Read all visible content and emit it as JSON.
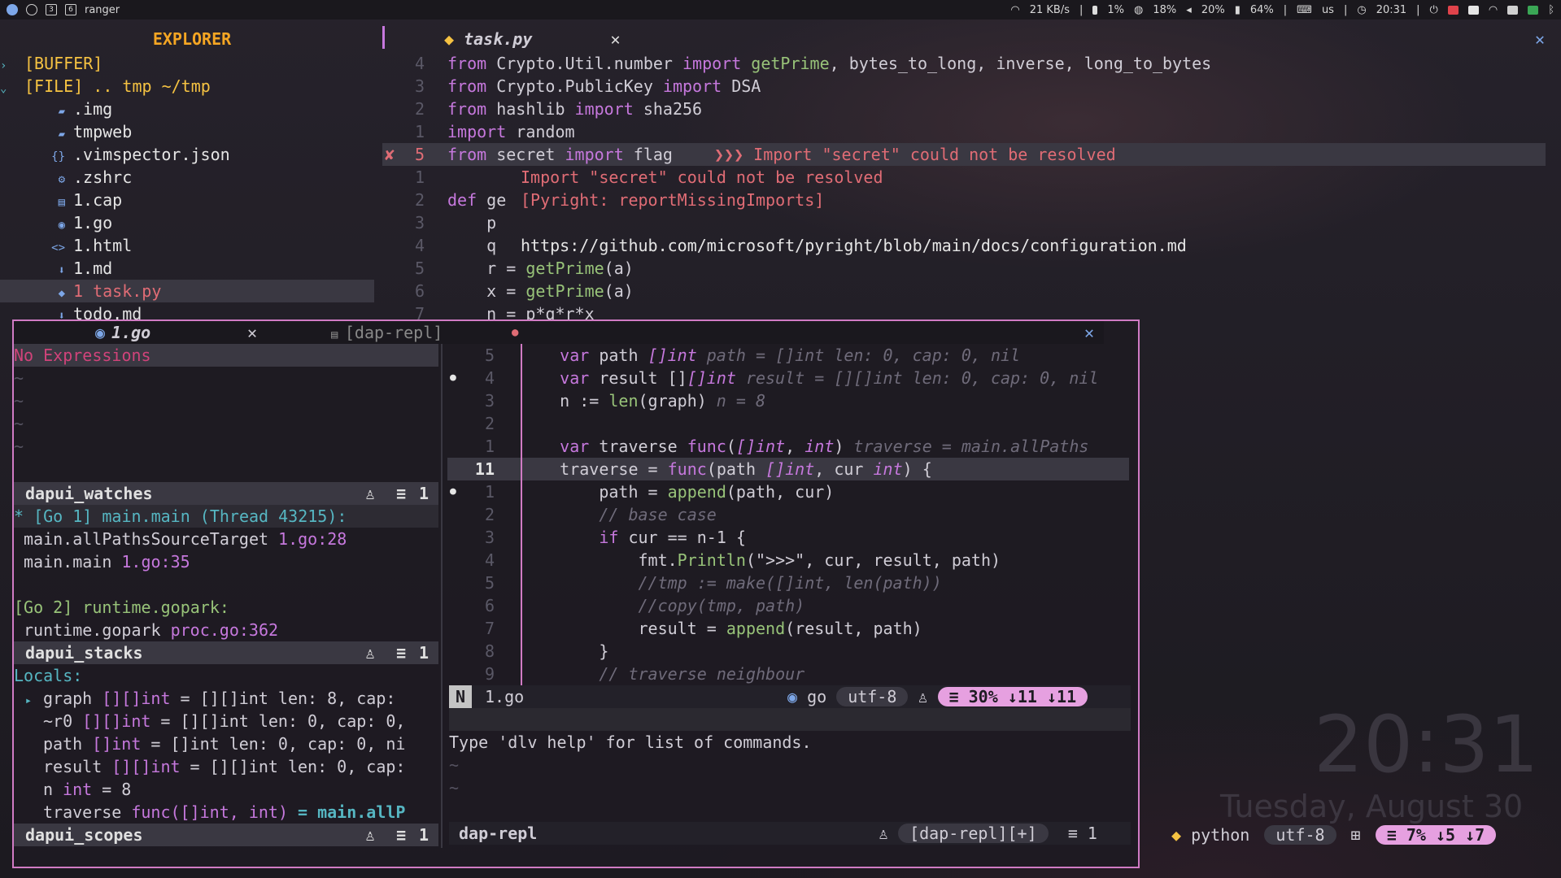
{
  "topbar": {
    "workspace_labels": [
      "3",
      "6"
    ],
    "window_title": "ranger",
    "net_speed": "21 KB/s",
    "cpu": "1%",
    "mem": "18%",
    "volume": "20%",
    "battery": "64%",
    "kbd_layout": "us",
    "time": "20:31"
  },
  "explorer": {
    "title": "EXPLORER",
    "items": [
      {
        "icon": "›",
        "label": "[BUFFER]",
        "indent": 0
      },
      {
        "icon": "⌄",
        "label": "[FILE] .. tmp ~/tmp",
        "indent": 0
      },
      {
        "icon": "▰",
        "label": ".img",
        "indent": 1
      },
      {
        "icon": "▰",
        "label": "tmpweb",
        "indent": 1
      },
      {
        "icon": "{}",
        "label": ".vimspector.json",
        "indent": 1
      },
      {
        "icon": "⚙",
        "label": ".zshrc",
        "indent": 1
      },
      {
        "icon": "▤",
        "label": "1.cap",
        "indent": 1
      },
      {
        "icon": "◉",
        "label": "1.go",
        "indent": 1
      },
      {
        "icon": "<>",
        "label": "1.html",
        "indent": 1
      },
      {
        "icon": "⬇",
        "label": "1.md",
        "indent": 1
      },
      {
        "icon": "◆",
        "label": "1 task.py",
        "indent": 1
      },
      {
        "icon": "⬇",
        "label": "todo.md",
        "indent": 1
      }
    ]
  },
  "editor": {
    "tab_label": "task.py",
    "code": [
      {
        "ln": "4",
        "text": "from Crypto.Util.number import getPrime, bytes_to_long, inverse, long_to_bytes"
      },
      {
        "ln": "3",
        "text": "from Crypto.PublicKey import DSA"
      },
      {
        "ln": "2",
        "text": "from hashlib import sha256"
      },
      {
        "ln": "1",
        "text": "import random"
      },
      {
        "ln": "5",
        "text": "from secret import flag"
      },
      {
        "ln": "1",
        "text": ""
      },
      {
        "ln": "2",
        "text": "def ge"
      },
      {
        "ln": "3",
        "text": "    p"
      },
      {
        "ln": "4",
        "text": "    q"
      },
      {
        "ln": "5",
        "text": "    r = getPrime(a)"
      },
      {
        "ln": "6",
        "text": "    x = getPrime(a)"
      },
      {
        "ln": "7",
        "text": "    n = p*q*r*x"
      }
    ],
    "diag_mark": "✘",
    "diag_inline": "❯❯❯ Import \"secret\" could not be resolved",
    "diag_popup": [
      "Import \"secret\" could not be resolved",
      "[Pyright: reportMissingImports]",
      "",
      "https://github.com/microsoft/pyright/blob/main/docs/configuration.md"
    ]
  },
  "dap": {
    "tab_go": "1.go",
    "tab_repl": "[dap-repl]",
    "no_expressions": "No Expressions",
    "watches_title": "dapui_watches",
    "stacks_title": "dapui_stacks",
    "scopes_title": "dapui_scopes",
    "pane_count": "1",
    "stacks": [
      {
        "prefix": "* ",
        "text": "[Go 1] main.main (Thread 43215):",
        "cls": "cyan"
      },
      {
        "fn": "main.allPathsSourceTarget",
        "loc": "1.go:28"
      },
      {
        "fn": "main.main",
        "loc": "1.go:35"
      },
      {
        "text": ""
      },
      {
        "text": "[Go 2] runtime.gopark:",
        "cls": "fn"
      },
      {
        "fn": "runtime.gopark",
        "loc": "proc.go:362"
      }
    ],
    "locals_label": "Locals:",
    "locals": [
      {
        "bullet": "▸",
        "name": "graph",
        "type": "[][]int",
        "val": "= [][]int len: 8, cap:"
      },
      {
        "bullet": "",
        "name": "~r0",
        "type": "[][]int",
        "val": "= [][]int len: 0, cap: 0,"
      },
      {
        "bullet": "",
        "name": "path",
        "type": "[]int",
        "val": "= []int len: 0, cap: 0, ni"
      },
      {
        "bullet": "",
        "name": "result",
        "type": "[][]int",
        "val": "= [][]int len: 0, cap:"
      },
      {
        "bullet": "",
        "name": "n",
        "type": "int",
        "val": "= 8"
      },
      {
        "bullet": "",
        "name": "traverse",
        "type": "func([]int, int)",
        "val": "= main.allP"
      }
    ],
    "go_code": [
      {
        "ln": "5",
        "bp": false,
        "text": "    var path []int",
        "hint": "path = []int len: 0, cap: 0, nil"
      },
      {
        "ln": "4",
        "bp": true,
        "text": "    var result [][]int",
        "hint": "result = [][]int len: 0, cap: 0, nil"
      },
      {
        "ln": "3",
        "bp": false,
        "text": "    n := len(graph)",
        "hint": "n = 8"
      },
      {
        "ln": "2",
        "bp": false,
        "text": "",
        "hint": ""
      },
      {
        "ln": "1",
        "bp": false,
        "text": "    var traverse func([]int, int)",
        "hint": "traverse = main.allPaths"
      },
      {
        "ln": "11",
        "bp": false,
        "text": "    traverse = func(path []int, cur int) {",
        "hint": "",
        "current": true
      },
      {
        "ln": "1",
        "bp": true,
        "text": "        path = append(path, cur)",
        "hint": ""
      },
      {
        "ln": "2",
        "bp": false,
        "text": "        // base case",
        "hint": "",
        "comment": true
      },
      {
        "ln": "3",
        "bp": false,
        "text": "        if cur == n-1 {",
        "hint": ""
      },
      {
        "ln": "4",
        "bp": false,
        "text": "            fmt.Println(\">>>\", cur, result, path)",
        "hint": ""
      },
      {
        "ln": "5",
        "bp": false,
        "text": "            //tmp := make([]int, len(path))",
        "hint": "",
        "comment": true
      },
      {
        "ln": "6",
        "bp": false,
        "text": "            //copy(tmp, path)",
        "hint": "",
        "comment": true
      },
      {
        "ln": "7",
        "bp": false,
        "text": "            result = append(result, path)",
        "hint": ""
      },
      {
        "ln": "8",
        "bp": false,
        "text": "        }",
        "hint": ""
      },
      {
        "ln": "9",
        "bp": false,
        "text": "        // traverse neighbour",
        "hint": "",
        "comment": true
      }
    ],
    "status_go": {
      "mode": "N",
      "file": "1.go",
      "ft": "go",
      "enc": "utf-8",
      "percent": "30%",
      "ln": "11",
      "col": "11"
    },
    "repl_text": "Type 'dlv help' for list of commands.",
    "repl_status_name": "dap-repl",
    "repl_status_tag": "[dap-repl][+]",
    "repl_count": "1"
  },
  "main_status": {
    "ft": "python",
    "enc": "utf-8",
    "percent": "7%",
    "ln": "5",
    "col": "7"
  },
  "desktop_clock": {
    "time": "20:31",
    "date": "Tuesday, August 30"
  },
  "colors": {
    "accent": "#c678dd",
    "error": "#e06c75",
    "border": "#d07bc4",
    "explorer_title": "#f5a623"
  }
}
